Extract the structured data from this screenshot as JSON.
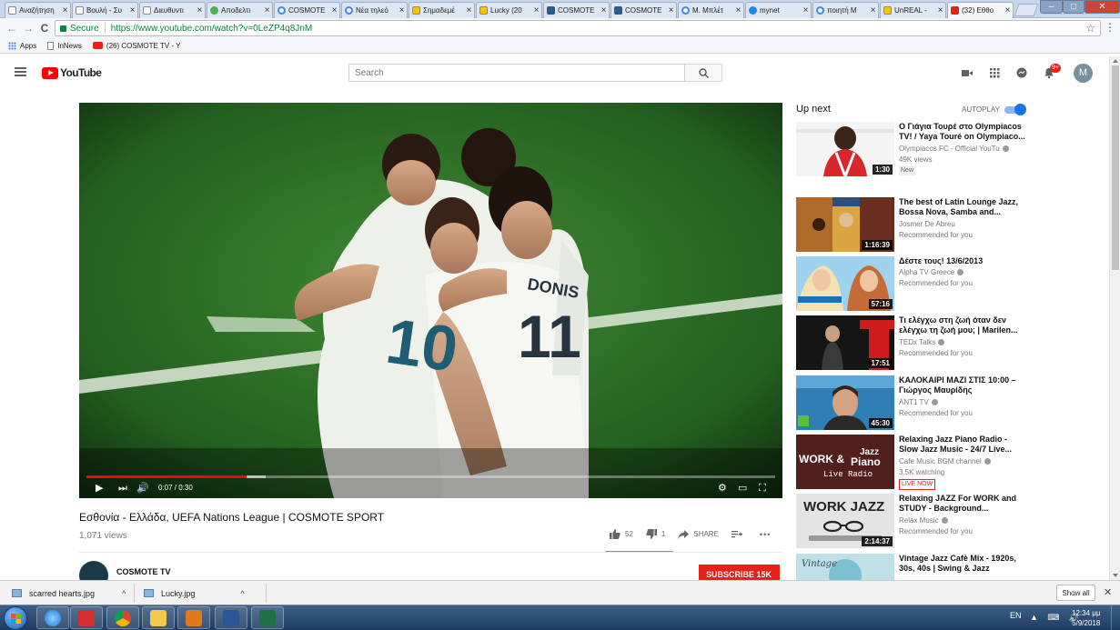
{
  "browser": {
    "tabs": [
      {
        "label": "Αναζήτηση",
        "icon": "page-icon",
        "active": false
      },
      {
        "label": "Βουλή - Συ",
        "icon": "page-icon",
        "active": false
      },
      {
        "label": "Διευθυντι",
        "icon": "page-icon",
        "active": false
      },
      {
        "label": "Αποδελτι",
        "icon": "site-icon",
        "active": false
      },
      {
        "label": "COSMOTE",
        "icon": "google-icon",
        "active": false
      },
      {
        "label": "Νέα τηλεό",
        "icon": "google-icon",
        "active": false
      },
      {
        "label": "Σημαδεμέ",
        "icon": "imdb-icon",
        "active": false
      },
      {
        "label": "Lucky (20",
        "icon": "imdb-icon",
        "active": false
      },
      {
        "label": "COSMOTE",
        "icon": "cosmote-icon",
        "active": false
      },
      {
        "label": "COSMOTE",
        "icon": "cosmote-icon",
        "active": false
      },
      {
        "label": "Μ. Μπλέτ",
        "icon": "google-icon",
        "active": false
      },
      {
        "label": "mynet",
        "icon": "mynet-icon",
        "active": false
      },
      {
        "label": "ποιητή Μ",
        "icon": "google-icon",
        "active": false
      },
      {
        "label": "UnREAL -",
        "icon": "imdb-icon",
        "active": false
      },
      {
        "label": "(32) Εθθο",
        "icon": "youtube-icon",
        "active": true
      }
    ],
    "tab_close_glyph": "×",
    "window_buttons": {
      "minimize": "–",
      "maximize": "□",
      "close": "✕"
    },
    "nav": {
      "back": "←",
      "forward": "→",
      "reload": "C"
    },
    "secure_label": "Secure",
    "url": "https://www.youtube.com/watch?v=0LeZP4q8JnM",
    "star": "☆",
    "menu": "⋮",
    "bookmarks": [
      {
        "label": "Apps",
        "icon": "apps-icon"
      },
      {
        "label": "InNews",
        "icon": "page-icon"
      },
      {
        "label": "(26) COSMOTE TV - Y",
        "icon": "youtube-icon"
      }
    ]
  },
  "youtube": {
    "logo_text": "YouTube",
    "search_placeholder": "Search",
    "notifications_badge": "9+",
    "avatar_letter": "M",
    "player": {
      "time": "0:07 / 0:30",
      "progress": 0.233,
      "buffered": 0.26,
      "play_glyph": "▶",
      "next_glyph": "⏭",
      "volume_glyph": "🔊",
      "settings_glyph": "⚙",
      "theater_glyph": "▭",
      "fullscreen_glyph": "⛶",
      "jersey_numbers": [
        "10",
        "11"
      ],
      "jersey_name": "DONIS"
    },
    "video": {
      "title": "Εσθονία - Ελλάδα, UEFA Nations League | COSMOTE SPORT",
      "views": "1,071 views",
      "likes": "52",
      "dislikes": "1",
      "share": "SHARE",
      "more": "•••",
      "channel": "COSMOTE TV",
      "subscribe": "SUBSCRIBE  15K"
    },
    "up_next_label": "Up next",
    "autoplay_label": "AUTOPLAY",
    "autoplay_on": true,
    "recommendations": [
      {
        "title": "Ο Γιάγια Τουρέ στο Olympiacos TV! / Yaya Touré on Olympiaco...",
        "channel": "Olympiacos FC - Official YouTu",
        "meta": "49K views",
        "badge": "New",
        "duration": "1:30"
      },
      {
        "title": "The best of Latin Lounge Jazz, Bossa Nova, Samba and...",
        "channel": "Josmer De Abreu",
        "meta": "Recommended for you",
        "badge": "",
        "duration": "1:16:39"
      },
      {
        "title": "Δέστε τους! 13/6/2013",
        "channel": "Alpha TV Greece",
        "meta": "Recommended for you",
        "badge": "",
        "duration": "57:16"
      },
      {
        "title": "Τι ελέγχω στη ζωή όταν δεν ελέγχω τη ζωή μου; | Marilen...",
        "channel": "TEDx Talks",
        "meta": "Recommended for you",
        "badge": "",
        "duration": "17:51"
      },
      {
        "title": "ΚΑΛΟΚΑΙΡΙ ΜΑΖΙ ΣΤΙΣ 10:00 – Γιώργος Μαυρίδης",
        "channel": "ANT1 TV",
        "meta": "Recommended for you",
        "badge": "",
        "duration": "45:30"
      },
      {
        "title": "Relaxing Jazz Piano Radio - Slow Jazz Music - 24/7 Live...",
        "channel": "Cafe Music BGM channel",
        "meta": "3.5K watching",
        "badge": "LIVE NOW",
        "duration": ""
      },
      {
        "title": "Relaxing JAZZ For WORK and STUDY - Background...",
        "channel": "Relax Music",
        "meta": "Recommended for you",
        "badge": "",
        "duration": "2:14:37"
      },
      {
        "title": "Vintage Jazz Cafè Mix - 1920s, 30s, 40s | Swing & Jazz",
        "channel": "",
        "meta": "",
        "badge": "",
        "duration": ""
      }
    ],
    "thumb_text": {
      "jazz_piano_line1": "WORK &",
      "jazz_piano_line2": "Jazz",
      "jazz_piano_line3": "Piano",
      "jazz_piano_line4": "Live Radio",
      "work_jazz": "WORK JAZZ",
      "vintage": "Vintage"
    }
  },
  "downloads": [
    {
      "name": "scarred hearts.jpg"
    },
    {
      "name": "Lucky.jpg"
    }
  ],
  "download_caret": "^",
  "show_all": "Show all",
  "shelf_close": "✕",
  "taskbar": {
    "lang": "EN",
    "tray_glyphs": "▲ ⌨ 🔊",
    "time": "12:34 μμ",
    "date": "5/9/2018"
  }
}
